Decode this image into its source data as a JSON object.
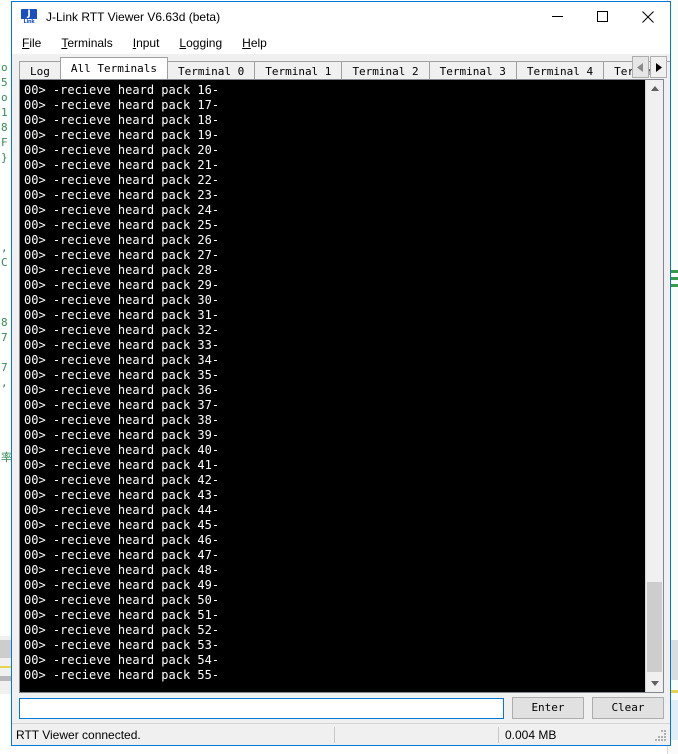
{
  "window": {
    "title": "J-Link RTT Viewer V6.63d (beta)",
    "icon_name": "jlink-icon",
    "icon_letter": "J",
    "icon_sub": "Link",
    "controls": {
      "minimize": "minimize-icon",
      "maximize": "maximize-icon",
      "close": "close-icon"
    },
    "accent_color": "#0078d7"
  },
  "menu": {
    "items": [
      {
        "label": "File",
        "accel": "F"
      },
      {
        "label": "Terminals",
        "accel": "T"
      },
      {
        "label": "Input",
        "accel": "I"
      },
      {
        "label": "Logging",
        "accel": "L"
      },
      {
        "label": "Help",
        "accel": "H"
      }
    ]
  },
  "tabs": {
    "active_index": 1,
    "items": [
      {
        "label": "Log"
      },
      {
        "label": "All Terminals"
      },
      {
        "label": "Terminal 0"
      },
      {
        "label": "Terminal 1"
      },
      {
        "label": "Terminal 2"
      },
      {
        "label": "Terminal 3"
      },
      {
        "label": "Terminal 4"
      },
      {
        "label": "Terminal"
      }
    ],
    "scroll_left_icon": "chevron-left-icon",
    "scroll_right_icon": "chevron-right-icon"
  },
  "terminal": {
    "background": "#000000",
    "foreground": "#ffffff",
    "lines": [
      "00> -recieve heard pack 16-",
      "00> -recieve heard pack 17-",
      "00> -recieve heard pack 18-",
      "00> -recieve heard pack 19-",
      "00> -recieve heard pack 20-",
      "00> -recieve heard pack 21-",
      "00> -recieve heard pack 22-",
      "00> -recieve heard pack 23-",
      "00> -recieve heard pack 24-",
      "00> -recieve heard pack 25-",
      "00> -recieve heard pack 26-",
      "00> -recieve heard pack 27-",
      "00> -recieve heard pack 28-",
      "00> -recieve heard pack 29-",
      "00> -recieve heard pack 30-",
      "00> -recieve heard pack 31-",
      "00> -recieve heard pack 32-",
      "00> -recieve heard pack 33-",
      "00> -recieve heard pack 34-",
      "00> -recieve heard pack 35-",
      "00> -recieve heard pack 36-",
      "00> -recieve heard pack 37-",
      "00> -recieve heard pack 38-",
      "00> -recieve heard pack 39-",
      "00> -recieve heard pack 40-",
      "00> -recieve heard pack 41-",
      "00> -recieve heard pack 42-",
      "00> -recieve heard pack 43-",
      "00> -recieve heard pack 44-",
      "00> -recieve heard pack 45-",
      "00> -recieve heard pack 46-",
      "00> -recieve heard pack 47-",
      "00> -recieve heard pack 48-",
      "00> -recieve heard pack 49-",
      "00> -recieve heard pack 50-",
      "00> -recieve heard pack 51-",
      "00> -recieve heard pack 52-",
      "00> -recieve heard pack 53-",
      "00> -recieve heard pack 54-",
      "00> -recieve heard pack 55-"
    ],
    "scrollbar": {
      "up_icon": "chevron-up-icon",
      "down_icon": "chevron-down-icon"
    }
  },
  "input_row": {
    "value": "",
    "placeholder": "",
    "enter_label": "Enter",
    "clear_label": "Clear"
  },
  "statusbar": {
    "message": "RTT Viewer connected.",
    "data_size": "0.004 MB",
    "grip_icon": "resize-grip-icon"
  },
  "background_window": {
    "code_fragment": "\n\n\n\no\n5\no\n1\n8\nF\n}\n\n\n\n\n\n,\nC\n\n\n\n8\n7\n\n7\n,\n\n\n\n\n率\n\n\n\n\n\n\n\n\n"
  }
}
